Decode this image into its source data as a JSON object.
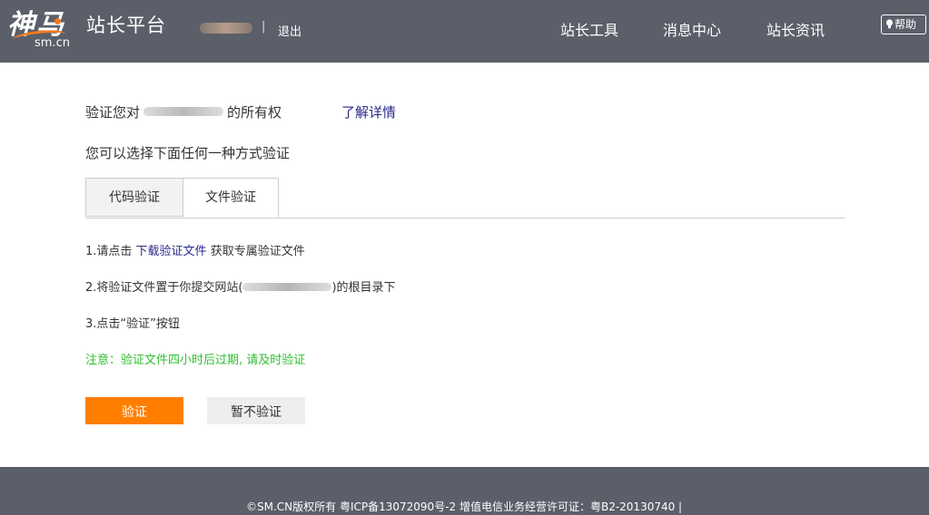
{
  "header": {
    "logo_text": "神马",
    "logo_sub": "sm.cn",
    "platform_title": "站长平台",
    "separator": "|",
    "logout_label": "退出",
    "nav": [
      "站长工具",
      "消息中心",
      "站长资讯"
    ],
    "help_label": "帮助"
  },
  "main": {
    "verify_prefix": "验证您对",
    "verify_suffix": "的所有权",
    "learn_more": "了解详情",
    "choose_text": "您可以选择下面任何一种方式验证",
    "tabs": [
      {
        "label": "代码验证",
        "active": false
      },
      {
        "label": "文件验证",
        "active": true
      }
    ],
    "step1_prefix": "1.请点击",
    "step1_link": "下载验证文件",
    "step1_suffix": "获取专属验证文件",
    "step2_prefix": "2.将验证文件置于你提交网站(",
    "step2_suffix": ")的根目录下",
    "step3": "3.点击“验证”按钮",
    "note": "注意：验证文件四小时后过期, 请及时验证",
    "verify_button": "验证",
    "skip_button": "暂不验证"
  },
  "footer": {
    "text": "©SM.CN版权所有   粤ICP备13072090号-2 增值电信业务经营许可证：粤B2-20130740   |"
  },
  "colors": {
    "header_bg": "#5a5f6a",
    "accent_orange": "#ff7e00",
    "note_green": "#2fbf2f",
    "link_blue": "#2a2a8a"
  }
}
